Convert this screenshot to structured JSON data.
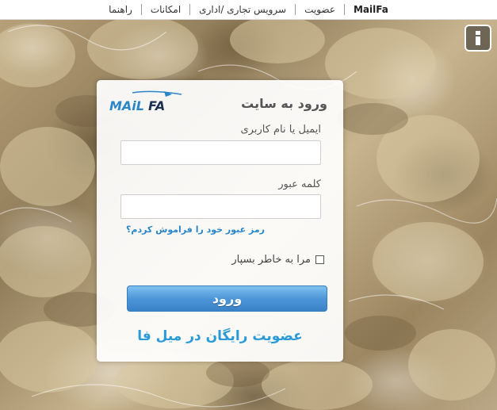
{
  "topnav": {
    "items": [
      {
        "label": "MailFa",
        "brand": true
      },
      {
        "label": "عضویت"
      },
      {
        "label": "سرویس تجاری /اداری"
      },
      {
        "label": "امکانات"
      },
      {
        "label": "راهنما"
      }
    ]
  },
  "info_button": {
    "icon": "info-icon"
  },
  "login": {
    "title": "ورود به سایت",
    "logo_text": "MAiLFA",
    "username_label": "ایمیل یا نام کاربری",
    "username_value": "",
    "password_label": "کلمه عبور",
    "password_value": "",
    "forgot_link": "رمز عبور خود را فراموش کردم؟",
    "remember_label": "مرا به خاطر بسپار",
    "remember_checked": false,
    "submit_label": "ورود",
    "signup_link": "عضویت رایگان در میل فا"
  },
  "colors": {
    "accent_blue": "#2a86c8",
    "button_blue": "#4d97d8",
    "card_bg": "#ffffff"
  }
}
